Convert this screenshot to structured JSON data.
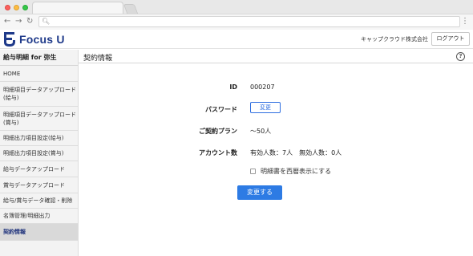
{
  "header": {
    "brand": "Focus U",
    "company": "キャップクラウド株式会社",
    "logout_label": "ログアウト"
  },
  "sidebar": {
    "title": "給与明細 for 弥生",
    "items": [
      {
        "label": "HOME",
        "active": false
      },
      {
        "label": "明細項目データアップロード(給与)",
        "active": false
      },
      {
        "label": "明細項目データアップロード(賞与)",
        "active": false
      },
      {
        "label": "明細出力項目設定(給与)",
        "active": false
      },
      {
        "label": "明細出力項目設定(賞与)",
        "active": false
      },
      {
        "label": "給与データアップロード",
        "active": false
      },
      {
        "label": "賞与データアップロード",
        "active": false
      },
      {
        "label": "給与/賞与データ確認・削除",
        "active": false
      },
      {
        "label": "名簿管理/明細出力",
        "active": false
      },
      {
        "label": "契約情報",
        "active": true
      }
    ]
  },
  "main": {
    "title": "契約情報",
    "help_icon": "question-circle-icon",
    "fields": {
      "id_label": "ID",
      "id_value": "000207",
      "password_label": "パスワード",
      "password_button": "変更",
      "plan_label": "ご契約プラン",
      "plan_value": "〜50人",
      "account_label": "アカウント数",
      "account_value": "有効人数：7人　無効人数：0人"
    },
    "checkbox_label": "明細書を西暦表示にする",
    "checkbox_checked": false,
    "submit_label": "変更する"
  },
  "colors": {
    "brand": "#1f3a8a",
    "accent": "#2d7be4",
    "active_nav_text": "#1b2f7a"
  }
}
